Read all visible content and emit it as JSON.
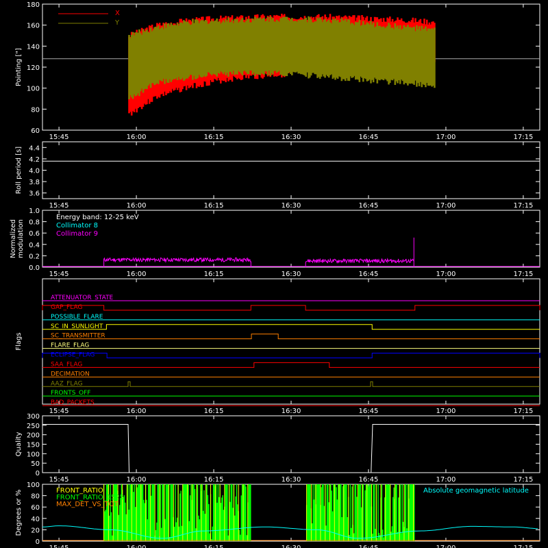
{
  "time_ticks": [
    "15:45",
    "16:00",
    "16:15",
    "16:30",
    "16:45",
    "17:00",
    "17:15"
  ],
  "chart_data": [
    {
      "type": "line",
      "ylabel": "Pointing [\"]",
      "ylim": [
        60,
        180
      ],
      "yticks": [
        60,
        80,
        100,
        120,
        140,
        160,
        180
      ],
      "reference_line": 128,
      "xlim_minutes": [
        -3.2,
        93.2
      ],
      "series": [
        {
          "name": "X",
          "color": "#ff0000",
          "t_start": 13.6,
          "t_end": 72.8,
          "upper": [
            150,
            160,
            164,
            166,
            167,
            168,
            168,
            168,
            167,
            166,
            165,
            163
          ],
          "lower": [
            75,
            92,
            100,
            106,
            110,
            112,
            114,
            116,
            118,
            120,
            122,
            124
          ]
        },
        {
          "name": "Y",
          "color": "#808000",
          "t_start": 13.6,
          "t_end": 72.8,
          "upper": [
            150,
            158,
            162,
            164,
            165,
            166,
            166,
            165,
            163,
            160,
            158,
            155
          ],
          "lower": [
            90,
            105,
            110,
            113,
            114,
            114,
            113,
            111,
            109,
            107,
            105,
            103
          ]
        }
      ]
    },
    {
      "type": "line",
      "ylabel": "Roll period [s]",
      "ylim": [
        3.5,
        4.5
      ],
      "yticks": [
        3.6,
        3.8,
        4.0,
        4.2,
        4.4
      ],
      "series": [
        {
          "color": "#ffffff",
          "x": [
            -3.2,
            93.2
          ],
          "y": [
            4.16,
            4.16
          ]
        }
      ]
    },
    {
      "type": "line",
      "ylabel": "Normalized modulation",
      "ylim": [
        0,
        1
      ],
      "yticks": [
        0.0,
        0.2,
        0.4,
        0.6,
        0.8,
        1.0
      ],
      "annotation": "Energy band: 12-25 keV",
      "series": [
        {
          "name": "Collimator 8",
          "color": "#00ffff",
          "segments": []
        },
        {
          "name": "Collimator 9",
          "color": "#ff00ff",
          "segments": [
            [
              8.7,
              37.2,
              0.13
            ],
            [
              47.8,
              68.8,
              0.11
            ]
          ],
          "spike": [
            68.8,
            0.52
          ]
        }
      ]
    },
    {
      "type": "step",
      "ylabel": "Flags",
      "flags": [
        {
          "name": "ATTENUATOR_STATE",
          "color": "#ff00ff",
          "highs": []
        },
        {
          "name": "GAP_FLAG",
          "color": "#ff0000",
          "highs": [
            [
              -3.2,
              8.7
            ],
            [
              37.2,
              47.8
            ],
            [
              69,
              93.2
            ]
          ]
        },
        {
          "name": "POSSIBLE_FLARE",
          "color": "#00ffff",
          "highs": []
        },
        {
          "name": "SC_IN_SUNLIGHT",
          "color": "#ffff00",
          "highs": [
            [
              9.2,
              60.7
            ]
          ]
        },
        {
          "name": "SC_TRANSMITTER",
          "color": "#ff8000",
          "highs": [
            [
              37.3,
              42.5
            ]
          ]
        },
        {
          "name": "FLARE_FLAG",
          "color": "#ffff80",
          "highs": []
        },
        {
          "name": "ECLIPSE_FLAG",
          "color": "#0000ff",
          "highs": [
            [
              -3.2,
              9.3
            ],
            [
              60.7,
              93.2
            ]
          ]
        },
        {
          "name": "SAA_FLAG",
          "color": "#ff0000",
          "highs": [
            [
              37.8,
              52.4
            ]
          ]
        },
        {
          "name": "DECIMATION",
          "color": "#ff8000",
          "highs": []
        },
        {
          "name": "AAZ_FLAG",
          "color": "#808000",
          "highs": [
            [
              13.4,
              13.8
            ],
            [
              60.4,
              60.8
            ]
          ]
        },
        {
          "name": "FRONTS_OFF",
          "color": "#00ff00",
          "highs": []
        },
        {
          "name": "BAD_PACKETS",
          "color": "#ff0000",
          "highs": []
        }
      ]
    },
    {
      "type": "line",
      "ylabel": "Quality",
      "ylim": [
        0,
        300
      ],
      "yticks": [
        0,
        50,
        100,
        150,
        200,
        250,
        300
      ],
      "series": [
        {
          "color": "#ffffff",
          "x": [
            -3.2,
            13.4,
            13.6,
            60.5,
            60.8,
            93.2
          ],
          "y": [
            255,
            255,
            0,
            0,
            255,
            255
          ]
        }
      ]
    },
    {
      "type": "line",
      "ylabel": "Degrees or %",
      "ylim": [
        0,
        100
      ],
      "yticks": [
        0,
        20,
        40,
        60,
        80,
        100
      ],
      "series": [
        {
          "name": "FRONT_RATIO",
          "color": "#ffff00",
          "bands": [
            [
              8.7,
              37.2
            ],
            [
              48.0,
              69.0
            ]
          ]
        },
        {
          "name": "FRONT_RATIO_1525",
          "color": "#00ff00",
          "bands": [
            [
              8.7,
              37.2
            ],
            [
              48.0,
              69.0
            ]
          ]
        },
        {
          "name": "MAX_DET_VS_TOT",
          "color": "#ff8000",
          "bands": []
        },
        {
          "name": "Absolute geomagnetic latitude",
          "color": "#00ffff",
          "x": [
            -3.2,
            0,
            10,
            20,
            28,
            40,
            50,
            58,
            70,
            80,
            88,
            93.2
          ],
          "y": [
            25,
            27,
            20,
            5,
            18,
            25,
            20,
            5,
            18,
            26,
            25,
            22
          ]
        }
      ]
    }
  ]
}
